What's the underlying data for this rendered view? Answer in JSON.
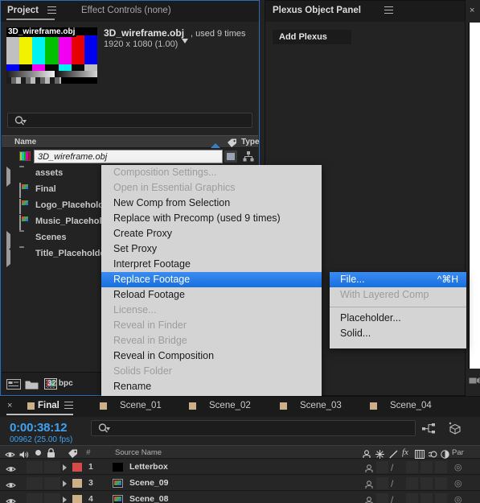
{
  "project_panel": {
    "tabs": [
      {
        "label": "Project",
        "active": true
      },
      {
        "label": "Effect Controls (none)",
        "active": false
      }
    ],
    "menu_icon": "hamburger-icon",
    "asset_preview": {
      "thumbnail_label": "3D_wireframe.obj",
      "title": "3D_wireframe.obj",
      "used_text": ", used 9 times",
      "dimensions": "1920 x 1080 (1.00)"
    },
    "search": {
      "placeholder": "",
      "value": "",
      "icon": "search-icon"
    },
    "columns": [
      {
        "label": "Name"
      },
      {
        "label": "Type"
      }
    ],
    "sort_arrow": "sort-ascending-icon",
    "tag_icon": "tag-icon",
    "editing_row": {
      "value": "3D_wireframe.obj",
      "icon": "color-bars-icon",
      "type_icon": "solid-swatch-icon",
      "share_icon": "share-hierarchy-icon"
    },
    "items": [
      {
        "label": "assets",
        "icon": "folder-icon",
        "expandable": true
      },
      {
        "label": "Final",
        "icon": "composition-icon",
        "expandable": false
      },
      {
        "label": "Logo_Placeholder",
        "icon": "composition-icon",
        "expandable": false
      },
      {
        "label": "Music_Placeholder",
        "icon": "composition-icon",
        "expandable": false
      },
      {
        "label": "Scenes",
        "icon": "folder-icon",
        "expandable": true
      },
      {
        "label": "Title_Placeholder",
        "icon": "folder-icon",
        "expandable": true
      }
    ],
    "bottom_bar": {
      "bit_depth": "32 bpc",
      "icons": [
        "interpret-footage-icon",
        "new-folder-icon",
        "new-composition-icon"
      ]
    }
  },
  "plexus_panel": {
    "title": "Plexus Object Panel",
    "menu_icon": "hamburger-icon",
    "add_button": "Add Plexus"
  },
  "right_strip": {
    "close_icon": "close-icon",
    "close_glyph": "×",
    "bottom_icon": "render-preview-icon"
  },
  "context_menu": {
    "items": [
      {
        "label": "Composition Settings...",
        "disabled": true,
        "submenu": false,
        "selected": false
      },
      {
        "label": "Open in Essential Graphics",
        "disabled": true,
        "submenu": false,
        "selected": false
      },
      {
        "label": "New Comp from Selection",
        "disabled": false,
        "submenu": false,
        "selected": false
      },
      {
        "label": "Replace with Precomp (used 9 times)",
        "disabled": false,
        "submenu": false,
        "selected": false
      },
      {
        "label": "Create Proxy",
        "disabled": false,
        "submenu": true,
        "selected": false
      },
      {
        "label": "Set Proxy",
        "disabled": false,
        "submenu": true,
        "selected": false
      },
      {
        "label": "Interpret Footage",
        "disabled": false,
        "submenu": true,
        "selected": false
      },
      {
        "label": "Replace Footage",
        "disabled": false,
        "submenu": true,
        "selected": true
      },
      {
        "label": "Reload Footage",
        "disabled": false,
        "submenu": false,
        "selected": false
      },
      {
        "label": "License...",
        "disabled": true,
        "submenu": false,
        "selected": false
      },
      {
        "label": "Reveal in Finder",
        "disabled": true,
        "submenu": false,
        "selected": false
      },
      {
        "label": "Reveal in Bridge",
        "disabled": true,
        "submenu": false,
        "selected": false
      },
      {
        "label": "Reveal in Composition",
        "disabled": false,
        "submenu": true,
        "selected": false
      },
      {
        "label": "Solids Folder",
        "disabled": true,
        "submenu": false,
        "selected": false
      },
      {
        "label": "Rename",
        "disabled": false,
        "submenu": false,
        "selected": false
      }
    ]
  },
  "sub_menu": {
    "items": [
      {
        "label": "File...",
        "shortcut": "^⌘H",
        "disabled": false,
        "selected": true,
        "separator_after": false
      },
      {
        "label": "With Layered Comp",
        "shortcut": "",
        "disabled": true,
        "selected": false,
        "separator_after": true
      },
      {
        "label": "Placeholder...",
        "shortcut": "",
        "disabled": false,
        "selected": false,
        "separator_after": false
      },
      {
        "label": "Solid...",
        "shortcut": "",
        "disabled": false,
        "selected": false,
        "separator_after": false
      }
    ]
  },
  "timeline": {
    "close_glyph": "×",
    "tabs": [
      {
        "label": "Final",
        "active": true
      },
      {
        "label": "Scene_01",
        "active": false
      },
      {
        "label": "Scene_02",
        "active": false
      },
      {
        "label": "Scene_03",
        "active": false
      },
      {
        "label": "Scene_04",
        "active": false
      }
    ],
    "menu_icon": "hamburger-icon",
    "current_time": "0:00:38:12",
    "frame_info": "00962 (25.00 fps)",
    "search": {
      "placeholder": "",
      "value": "",
      "icon": "search-icon"
    },
    "toolbar_icons": [
      "composition-mini-flowchart-icon",
      "draft-3d-icon"
    ],
    "column_headers": {
      "video_icon": "eye-icon",
      "audio_icon": "speaker-icon",
      "solo_icon": "solo-dot-icon",
      "lock_icon": "lock-icon",
      "tag_icon": "tag-icon",
      "number": "#",
      "source_name": "Source Name",
      "switch_icons": [
        "shy-icon",
        "collapse-transformations-icon",
        "quality-icon",
        "effects-fx-icon",
        "frame-blend-icon",
        "motion-blur-icon",
        "adjustment-layer-icon",
        "3d-layer-icon"
      ],
      "parent": "Par"
    },
    "layers": [
      {
        "number": "1",
        "name": "Letterbox",
        "color": "#d84a4a",
        "source_icon": "solid-icon",
        "parent_icon": "pickwhip-icon"
      },
      {
        "number": "3",
        "name": "Scene_09",
        "color": "#cbb08a",
        "source_icon": "composition-icon",
        "parent_icon": "pickwhip-icon"
      },
      {
        "number": "4",
        "name": "Scene_08",
        "color": "#cbb08a",
        "source_icon": "composition-icon",
        "parent_icon": "pickwhip-icon"
      }
    ]
  },
  "colors": {
    "panel_bg": "#232323",
    "tabbar_bg": "#1b1b1b",
    "active_panel_border": "#2b6cb8",
    "menu_bg": "#d4d4d4",
    "menu_highlight": "#2f7fe8",
    "accent_blue": "#3fa2ef"
  }
}
